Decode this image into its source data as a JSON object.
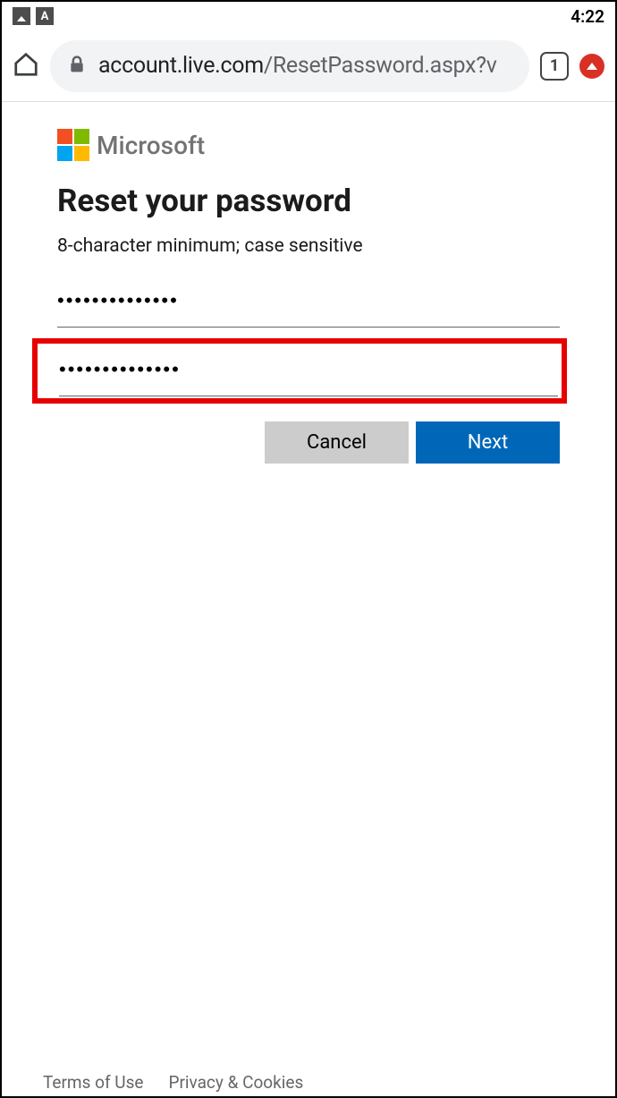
{
  "status": {
    "time": "4:22"
  },
  "browser": {
    "url_domain": "account.live.com",
    "url_path": "/ResetPassword.aspx?v",
    "tab_count": "1"
  },
  "brand": {
    "name": "Microsoft"
  },
  "form": {
    "heading": "Reset your password",
    "hint": "8-character minimum; case sensitive",
    "password1": "••••••••••••••",
    "password2": "••••••••••••••",
    "cancel": "Cancel",
    "next": "Next"
  },
  "footer": {
    "terms": "Terms of Use",
    "privacy": "Privacy & Cookies"
  }
}
